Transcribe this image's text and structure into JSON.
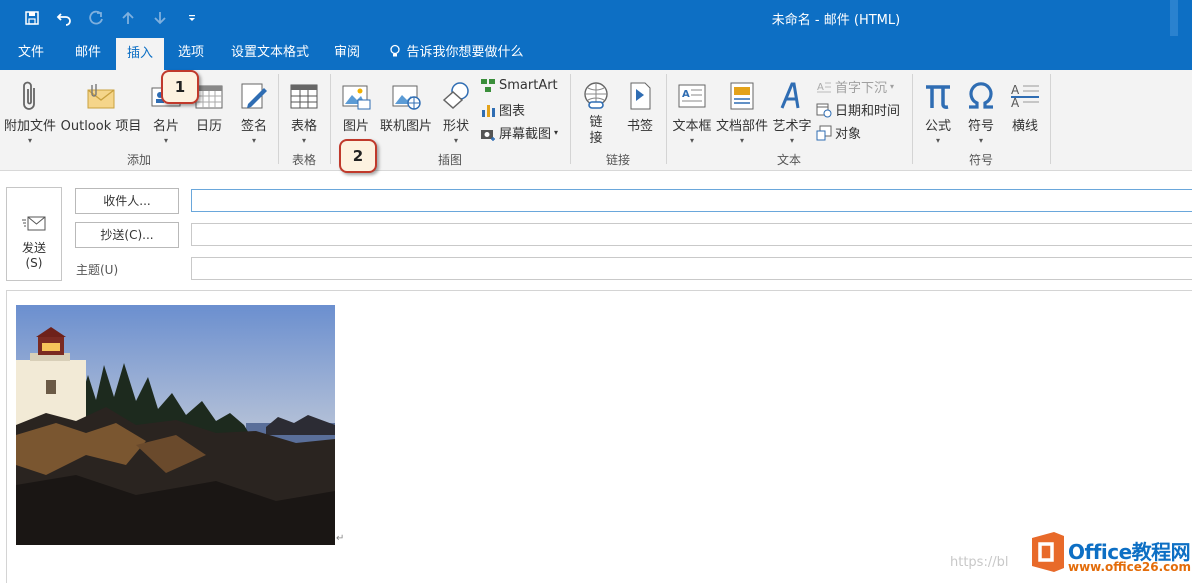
{
  "window": {
    "title": "未命名 - 邮件 (HTML)"
  },
  "tabs": [
    "文件",
    "邮件",
    "插入",
    "选项",
    "设置文本格式",
    "审阅"
  ],
  "active_tab": "插入",
  "tell_me": "告诉我你想要做什么",
  "ribbon": {
    "add": {
      "attach": "附加文件",
      "outlook_item": "Outlook 项目",
      "card": "名片",
      "calendar": "日历",
      "signature": "签名",
      "label": "添加"
    },
    "table": {
      "table": "表格",
      "label": "表格"
    },
    "illustrations": {
      "picture": "图片",
      "online_picture": "联机图片",
      "shapes": "形状",
      "smartart": "SmartArt",
      "chart": "图表",
      "screenshot": "屏幕截图",
      "label": "插图"
    },
    "links": {
      "link": "链接",
      "bookmark": "书签",
      "label": "链接"
    },
    "text": {
      "textbox": "文本框",
      "quickparts": "文档部件",
      "wordart": "艺术字",
      "dropcap": "首字下沉",
      "datetime": "日期和时间",
      "object": "对象",
      "label": "文本"
    },
    "symbols": {
      "equation": "公式",
      "symbol": "符号",
      "hline": "横线",
      "label": "符号"
    }
  },
  "callouts": [
    "1",
    "2"
  ],
  "compose": {
    "send": "发送",
    "send_key": "(S)",
    "to_button": "收件人...",
    "cc_button": "抄送(C)...",
    "subject_label": "主题(U)",
    "to_value": "",
    "cc_value": "",
    "subject_value": ""
  },
  "watermark": {
    "url": "https://bl",
    "name": "Office教程网",
    "site": "www.office26.com"
  },
  "colors": {
    "accent": "#0d6fc4",
    "ribbon_bg": "#f3f3f3",
    "callout_border": "#c0392b"
  }
}
